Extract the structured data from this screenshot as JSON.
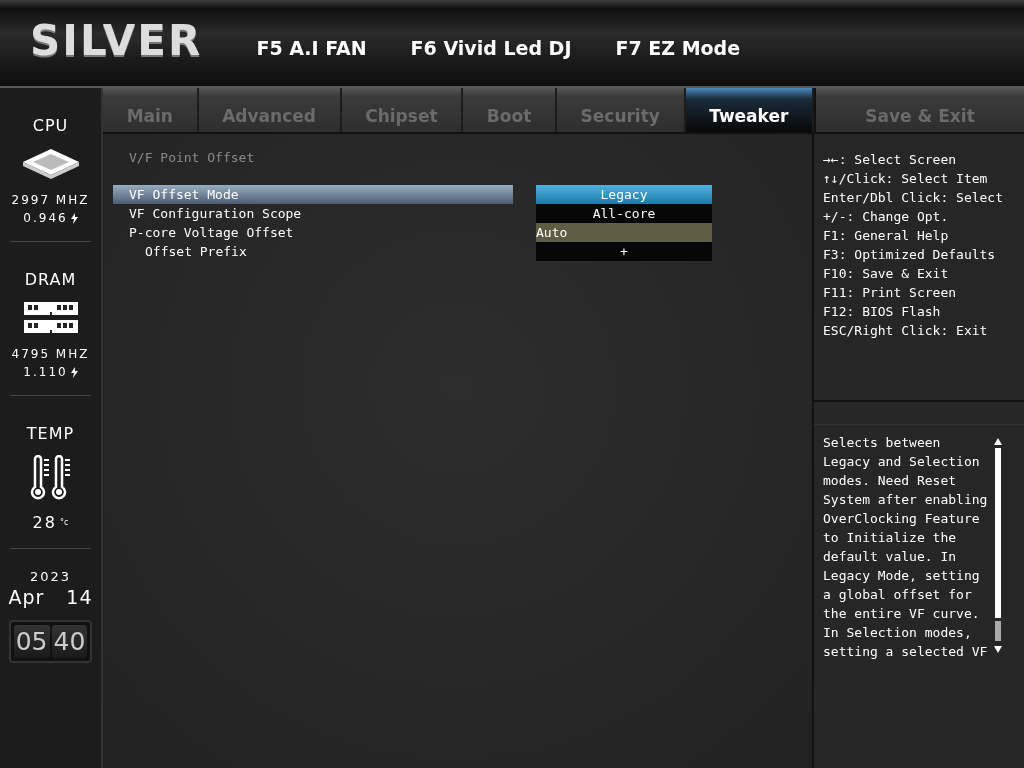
{
  "header": {
    "logo": "SILVER",
    "hotkeys": [
      "F5 A.I FAN",
      "F6 Vivid Led DJ",
      "F7 EZ Mode"
    ]
  },
  "tabs": [
    {
      "label": "Main",
      "selected": false
    },
    {
      "label": "Advanced",
      "selected": false
    },
    {
      "label": "Chipset",
      "selected": false
    },
    {
      "label": "Boot",
      "selected": false
    },
    {
      "label": "Security",
      "selected": false
    },
    {
      "label": "Tweaker",
      "selected": true
    },
    {
      "label": "Save & Exit",
      "selected": false
    }
  ],
  "sidebar": {
    "cpu": {
      "label": "CPU",
      "frequency": "2997 MHZ",
      "voltage": "0.946"
    },
    "dram": {
      "label": "DRAM",
      "frequency": "4795 MHZ",
      "voltage": "1.110"
    },
    "temp": {
      "label": "TEMP",
      "value": "28",
      "unit": "°c"
    },
    "date": {
      "year": "2023",
      "month": "Apr",
      "day": "14"
    },
    "clock": {
      "hours": "05",
      "minutes": "40"
    }
  },
  "section_title": "V/F Point Offset",
  "settings": [
    {
      "label": "VF Offset Mode",
      "selected": true,
      "value": {
        "kind": "option",
        "text": "Legacy"
      }
    },
    {
      "label": "VF Configuration Scope",
      "selected": false,
      "value": {
        "kind": "option",
        "text": "All-core"
      }
    },
    {
      "label": "P-core Voltage Offset",
      "selected": false,
      "value": {
        "kind": "input",
        "text": "Auto"
      },
      "children": [
        {
          "label": "Offset Prefix",
          "selected": false,
          "value": {
            "kind": "option",
            "text": "+"
          }
        }
      ]
    }
  ],
  "key_help": [
    "→←: Select Screen",
    "↑↓/Click: Select Item",
    "Enter/Dbl Click: Select",
    "+/-: Change Opt.",
    "F1: General Help",
    "F3: Optimized Defaults",
    "F10: Save & Exit",
    "F11: Print Screen",
    "F12: BIOS Flash",
    "ESC/Right Click: Exit"
  ],
  "description": "Selects between Legacy and Selection modes. Need Reset System after enabling OverClocking Feature to Initialize the default value. In Legacy Mode, setting a global offset for the entire VF curve. In Selection modes, setting a selected VF"
}
